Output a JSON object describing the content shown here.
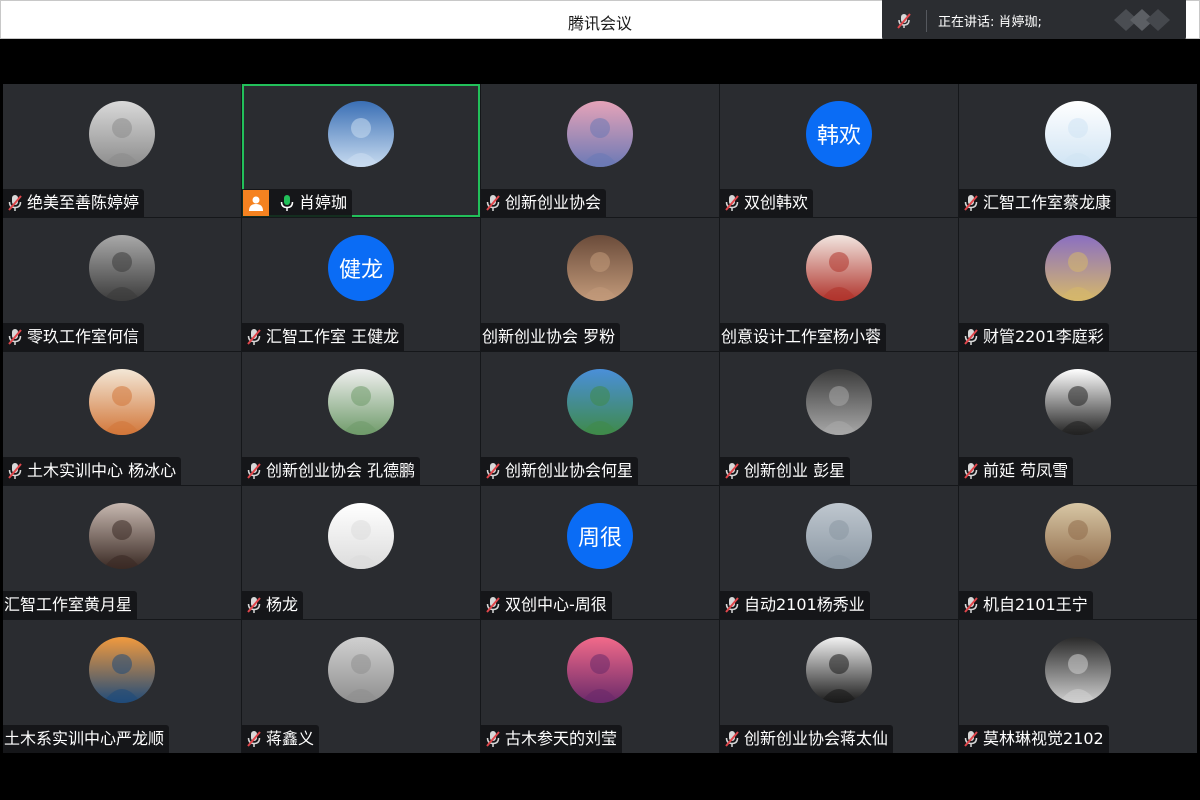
{
  "window": {
    "title": "腾讯会议"
  },
  "speaking_indicator": {
    "label": "正在讲话: 肖婷珈;"
  },
  "colors": {
    "active_speaker": "#22c05a",
    "host_badge": "#f58220",
    "text_avatar": "#0a6cf5",
    "muted_mic": "#e0464b"
  },
  "participants": [
    {
      "name": "绝美至善陈婷婷",
      "mic": "muted",
      "avatar": "photo"
    },
    {
      "name": "肖婷珈",
      "mic": "on",
      "avatar": "photo",
      "host": true,
      "active": true
    },
    {
      "name": "创新创业协会",
      "mic": "muted",
      "avatar": "photo"
    },
    {
      "name": "双创韩欢",
      "mic": "muted",
      "avatar_text": "韩欢"
    },
    {
      "name": "汇智工作室蔡龙康",
      "mic": "muted",
      "avatar": "photo"
    },
    {
      "name": "零玖工作室何信",
      "mic": "muted",
      "avatar": "photo"
    },
    {
      "name": "汇智工作室  王健龙",
      "mic": "muted",
      "avatar_text": "健龙"
    },
    {
      "name": "创新创业协会 罗粉",
      "mic": "none",
      "avatar": "photo"
    },
    {
      "name": "创意设计工作室杨小蓉",
      "mic": "none",
      "avatar": "photo"
    },
    {
      "name": "财管2201李庭彩",
      "mic": "muted",
      "avatar": "photo"
    },
    {
      "name": "土木实训中心   杨冰心",
      "mic": "muted",
      "avatar": "photo"
    },
    {
      "name": "创新创业协会 孔德鹏",
      "mic": "muted",
      "avatar": "photo"
    },
    {
      "name": "创新创业协会何星",
      "mic": "muted",
      "avatar": "photo"
    },
    {
      "name": "创新创业 彭星",
      "mic": "muted",
      "avatar": "photo"
    },
    {
      "name": "前延 苟凤雪",
      "mic": "muted",
      "avatar": "photo"
    },
    {
      "name": "汇智工作室黄月星",
      "mic": "none",
      "avatar": "photo"
    },
    {
      "name": "杨龙",
      "mic": "muted",
      "avatar": "photo"
    },
    {
      "name": "双创中心-周很",
      "mic": "muted",
      "avatar_text": "周很"
    },
    {
      "name": "自动2101杨秀业",
      "mic": "muted",
      "avatar": "photo"
    },
    {
      "name": "机自2101王宁",
      "mic": "muted",
      "avatar": "photo"
    },
    {
      "name": "土木系实训中心严龙顺",
      "mic": "none",
      "avatar": "photo"
    },
    {
      "name": "蒋鑫义",
      "mic": "muted",
      "avatar": "photo"
    },
    {
      "name": "古木参天的刘莹",
      "mic": "muted",
      "avatar": "photo"
    },
    {
      "name": "创新创业协会蒋太仙",
      "mic": "muted",
      "avatar": "photo"
    },
    {
      "name": "莫林琳视觉2102",
      "mic": "muted",
      "avatar": "photo"
    }
  ]
}
